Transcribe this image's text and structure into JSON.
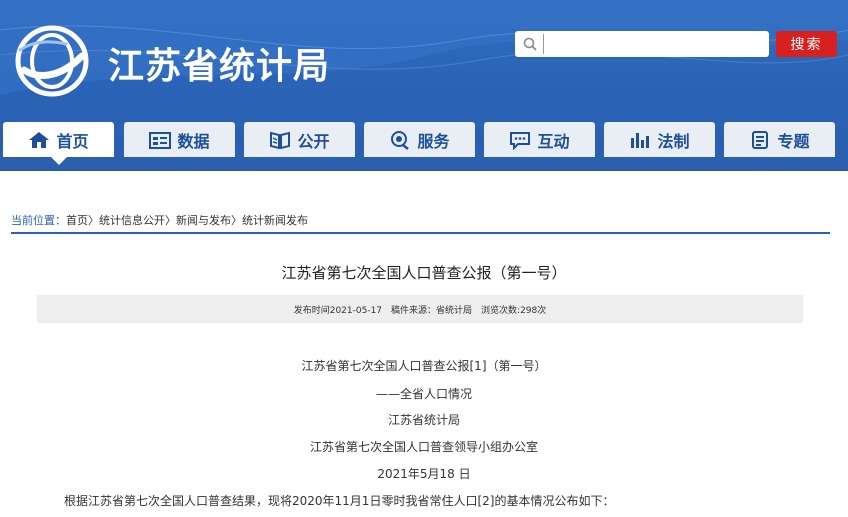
{
  "header": {
    "site_title": "江苏省统计局",
    "search_placeholder": "",
    "search_button": "搜索",
    "logo_icon": "jiangsu-stats-emblem",
    "search_icon": "magnifier-icon"
  },
  "nav": {
    "items": [
      {
        "label": "首页",
        "icon": "home-icon"
      },
      {
        "label": "数据",
        "icon": "data-icon"
      },
      {
        "label": "公开",
        "icon": "disclosure-icon"
      },
      {
        "label": "服务",
        "icon": "service-icon"
      },
      {
        "label": "互动",
        "icon": "chat-icon"
      },
      {
        "label": "法制",
        "icon": "law-icon"
      },
      {
        "label": "专题",
        "icon": "topic-icon"
      }
    ]
  },
  "breadcrumb": {
    "lead": "当前位置：",
    "items": [
      "首页",
      "统计信息公开",
      "新闻与发布",
      "统计新闻发布"
    ],
    "separator": "〉"
  },
  "article": {
    "title": "江苏省第七次全国人口普查公报（第一号）",
    "meta": {
      "publish_time": "发布时间2021-05-17",
      "source": "稿件来源：省统计局",
      "views": "浏览次数:298次"
    },
    "content": {
      "line1": "江苏省第七次全国人口普查公报[1]（第一号）",
      "line2": "——全省人口情况",
      "line3": "江苏省统计局",
      "line4": "江苏省第七次全国人口普查领导小组办公室",
      "line5": "2021年5月18 日",
      "para1": "根据江苏省第七次全国人口普查结果，现将2020年11月1日零时我省常住人口[2]的基本情况公布如下："
    }
  },
  "colors": {
    "header_blue": "#2f6cc0",
    "nav_text": "#1d4f9a",
    "search_red": "#d8211e",
    "rule_blue": "#2c62b0"
  }
}
